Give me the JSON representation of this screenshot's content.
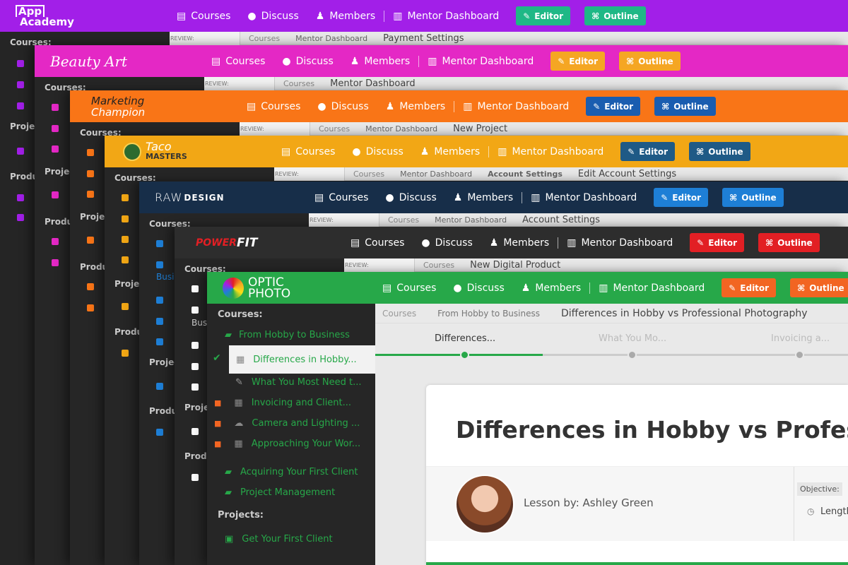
{
  "nav": {
    "courses": "Courses",
    "discuss": "Discuss",
    "members": "Members",
    "mentor_dashboard": "Mentor Dashboard",
    "editor": "Editor",
    "outline": "Outline"
  },
  "common": {
    "review": "REVIEW:",
    "courses_heading": "Courses:",
    "projects_heading": "Projects:",
    "products_heading": "Produ",
    "projects_short": "Projec",
    "courses_crumb": "Courses",
    "mentor_crumb": "Mentor Dashboard"
  },
  "layers": [
    {
      "brand_line1": "App",
      "brand_line2": "Academy",
      "header_color": "#a21fe8",
      "btn_color": "#1fb886",
      "crumb_last": "Payment Settings",
      "icon_color": "#a21fe8"
    },
    {
      "brand_line1": "Beauty Art",
      "brand_line2": "",
      "header_color": "#e428c5",
      "btn_color": "#f5a623",
      "crumb_last": "Mentor Dashboard",
      "icon_color": "#e428c5"
    },
    {
      "brand_line1": "Marketing",
      "brand_line2": "Champion",
      "header_color": "#f97517",
      "btn_color": "#1a5db0",
      "crumb_last": "New Project",
      "icon_color": "#f97517"
    },
    {
      "brand_line1": "Taco",
      "brand_line2": "MASTERS",
      "header_color": "#f2a715",
      "btn_color": "#1f5a86",
      "crumb_mid": "Account Settings",
      "crumb_last": "Edit Account Settings",
      "icon_color": "#f2a715"
    },
    {
      "brand_line1": "RAW",
      "brand_line2": "DESIGN",
      "header_color": "#172e49",
      "btn_color": "#1e7fd6",
      "crumb_last": "Account Settings",
      "icon_color": "#1e7fd6"
    },
    {
      "brand_line1": "POWER",
      "brand_line2": "FIT",
      "header_color": "#2d2d2d",
      "btn_color": "#e21f24",
      "crumb_last": "New Digital Product",
      "icon_color": "#ffffff",
      "side_extra": "Bus"
    },
    {
      "brand_line1": "OPTIC",
      "brand_line2": "PHOTO",
      "header_color": "#27a849",
      "btn_color": "#f26522"
    }
  ],
  "front": {
    "crumb_1": "Courses",
    "crumb_2": "From Hobby to Business",
    "crumb_3": "Differences in Hobby vs Professional Photography",
    "steps": [
      "Differences...",
      "What You Mo...",
      "Invoicing a..."
    ],
    "courses_heading": "Courses:",
    "course_main": "From Hobby to Business",
    "lessons": [
      {
        "label": "Differences in Hobby...",
        "status": "done",
        "icon": "film-icon"
      },
      {
        "label": "What You Most Need t...",
        "status": "open",
        "icon": "pencil-icon"
      },
      {
        "label": "Invoicing and Client...",
        "status": "locked",
        "icon": "film-icon"
      },
      {
        "label": "Camera and Lighting ...",
        "status": "locked",
        "icon": "cloud-icon"
      },
      {
        "label": "Approaching Your Wor...",
        "status": "locked",
        "icon": "film-icon"
      }
    ],
    "course_2": "Acquiring Your First Client",
    "course_3": "Project Management",
    "projects_heading": "Projects:",
    "project_1": "Get Your First Client",
    "lesson_title": "Differences in Hobby vs Profession",
    "lesson_by": "Lesson by: Ashley Green",
    "objective": "Objective:",
    "length": "Length",
    "accent": "#27a849"
  },
  "side_extra_busi": "Busi"
}
